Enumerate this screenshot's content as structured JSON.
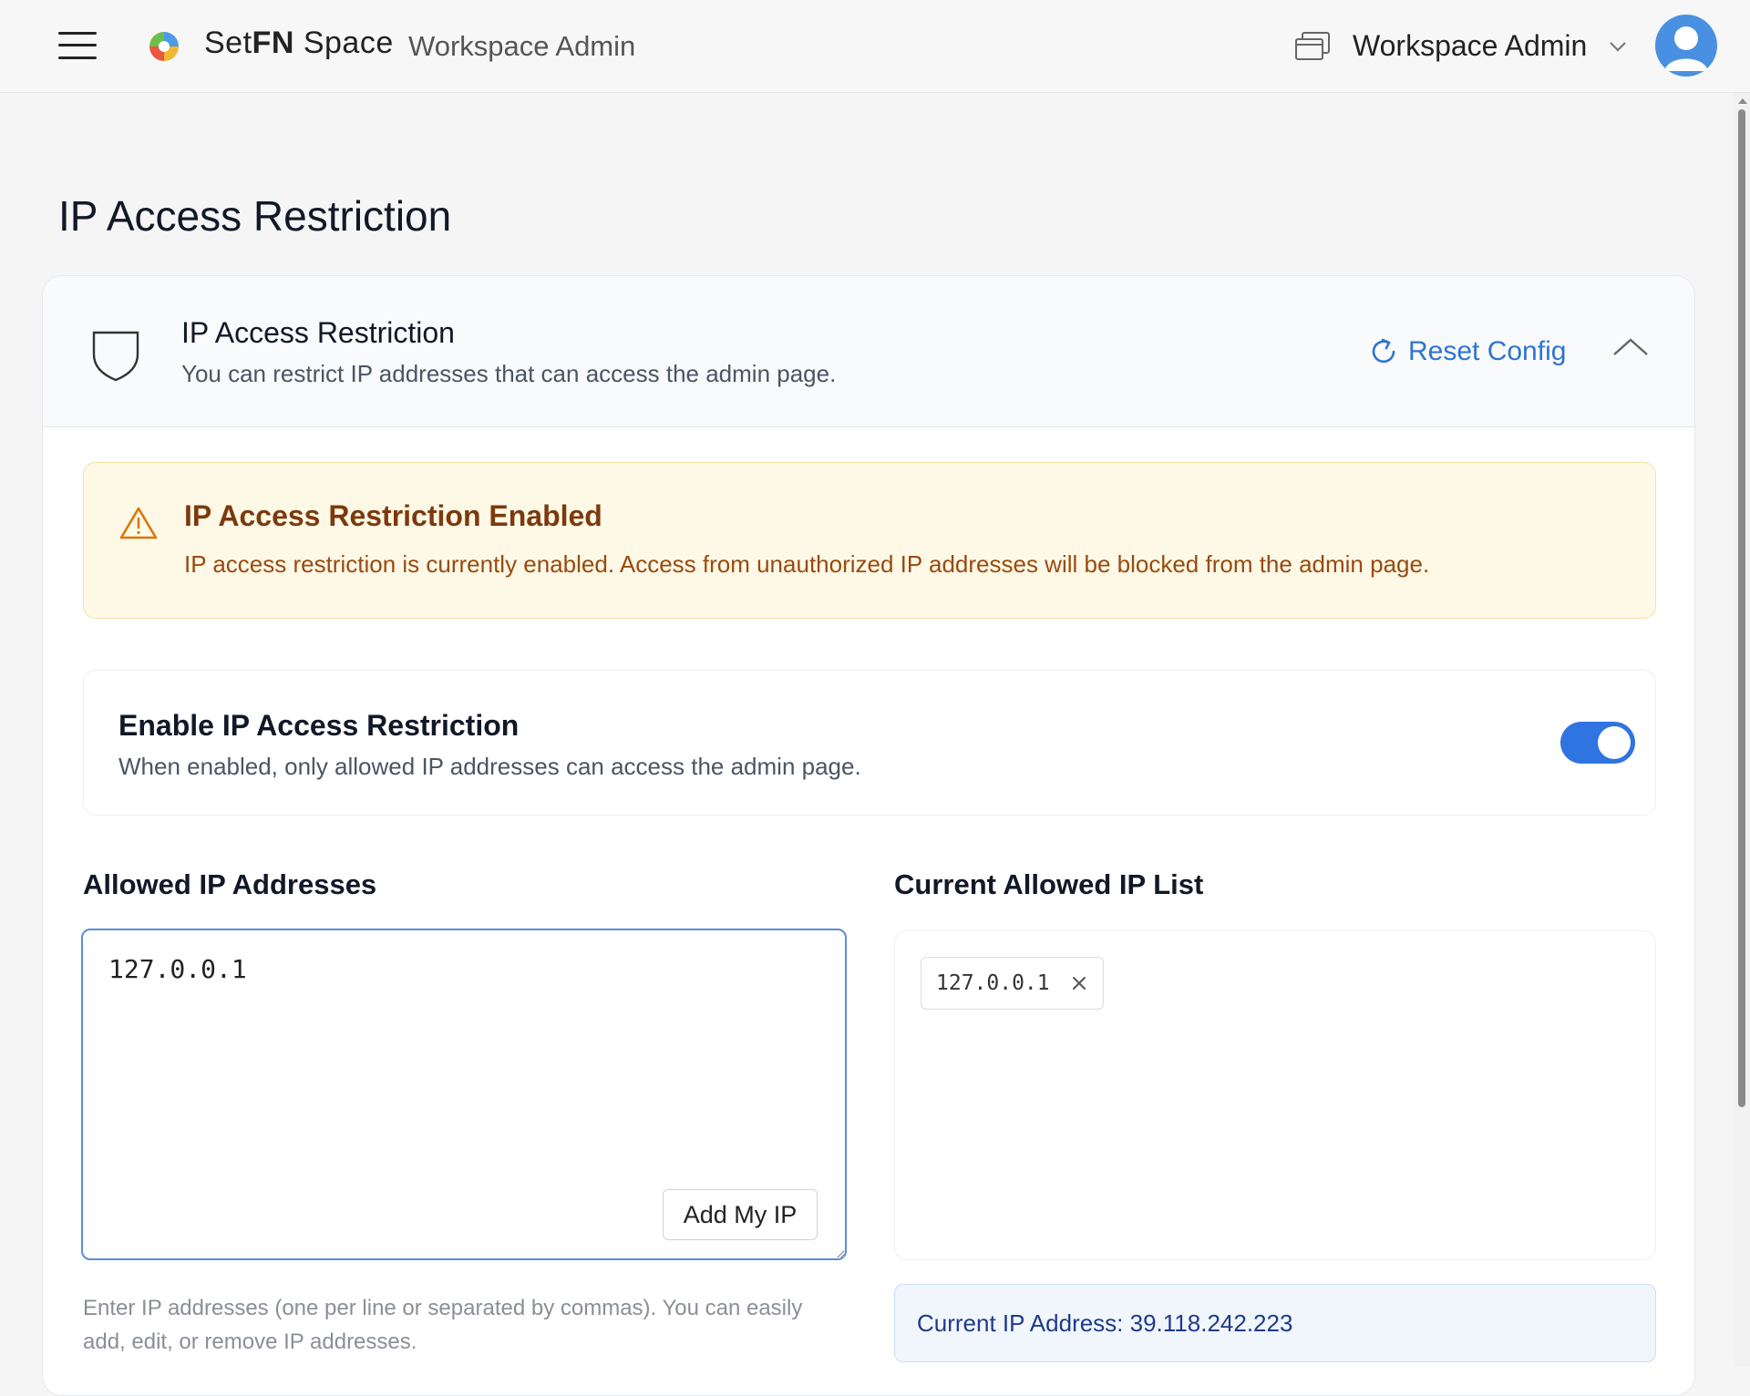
{
  "header": {
    "brand_prefix": "Set",
    "brand_fn": "FN",
    "brand_suffix": " Space",
    "brand_subtitle": "Workspace Admin",
    "workspace_name": "Workspace Admin"
  },
  "page": {
    "title": "IP Access Restriction"
  },
  "card": {
    "title": "IP Access Restriction",
    "description": "You can restrict IP addresses that can access the admin page.",
    "reset_label": "Reset Config"
  },
  "warning": {
    "title": "IP Access Restriction Enabled",
    "text": "IP access restriction is currently enabled. Access from unauthorized IP addresses will be blocked from the admin page."
  },
  "toggle": {
    "title": "Enable IP Access Restriction",
    "description": "When enabled, only allowed IP addresses can access the admin page.",
    "enabled": true
  },
  "allowed": {
    "label": "Allowed IP Addresses",
    "value": "127.0.0.1",
    "add_my_ip_label": "Add My IP",
    "helper": "Enter IP addresses (one per line or separated by commas). You can easily add, edit, or remove IP addresses."
  },
  "current_list": {
    "label": "Current Allowed IP List",
    "items": [
      "127.0.0.1"
    ]
  },
  "current_ip": {
    "text": "Current IP Address: 39.118.242.223"
  },
  "colors": {
    "accent": "#2f74e0",
    "warning_bg": "#fef9e7",
    "warning_title": "#7c3a0d",
    "info_text": "#1e3a8a"
  },
  "icons": {
    "menu": "hamburger-icon",
    "logo": "logo-icon",
    "workspace": "windows-icon",
    "account_chevron": "chevron-down-icon",
    "avatar": "user-avatar-icon",
    "card": "shield-icon",
    "reset": "refresh-icon",
    "collapse": "chevron-up-icon",
    "warning": "warning-triangle-icon",
    "chip_remove": "close-icon"
  }
}
